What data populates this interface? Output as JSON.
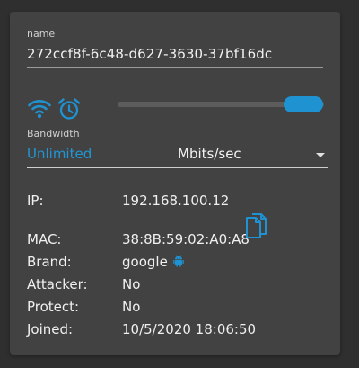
{
  "device": {
    "name_label": "name",
    "name_value": "272ccf8f-6c48-d627-3630-37bf16dc"
  },
  "bandwidth": {
    "label": "Bandwidth",
    "value": "Unlimited",
    "unit_selected": "Mbits/sec",
    "slider_level": 1.0
  },
  "icons": {
    "wifi": "wifi-icon",
    "alarm": "alarm-clock-icon",
    "copy": "copy-icon",
    "android": "android-icon"
  },
  "info": {
    "ip_label": "IP:",
    "ip_value": "192.168.100.12",
    "mac_label": "MAC:",
    "mac_value": "38:8B:59:02:A0:A8",
    "brand_label": "Brand:",
    "brand_value": "google",
    "attacker_label": "Attacker:",
    "attacker_value": "No",
    "protect_label": "Protect:",
    "protect_value": "No",
    "joined_label": "Joined:",
    "joined_value": "10/5/2020 18:06:50"
  },
  "colors": {
    "accent": "#2196d3",
    "card_bg": "#424242",
    "page_bg": "#2f2f2f"
  }
}
